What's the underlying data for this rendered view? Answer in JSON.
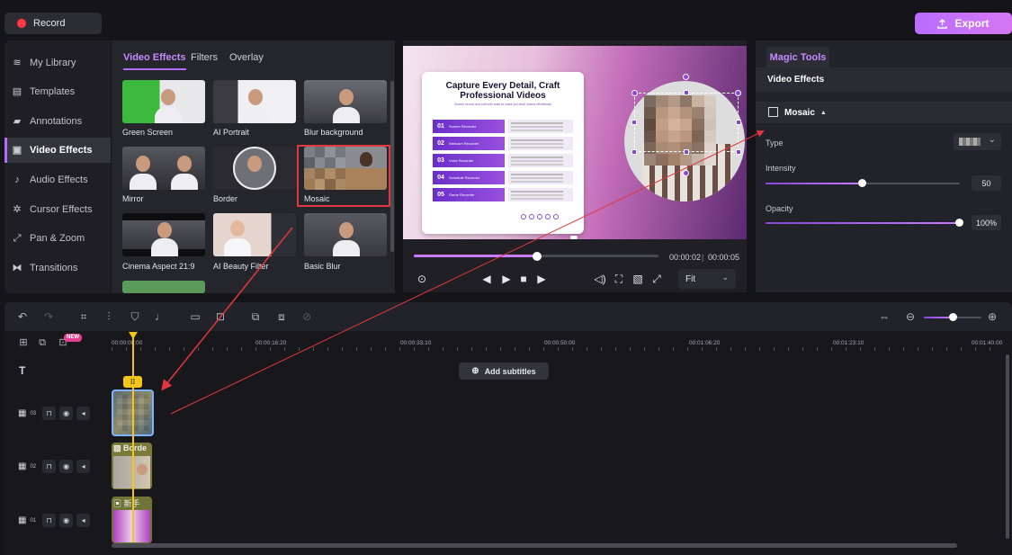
{
  "topbar": {
    "record_label": "Record",
    "export_label": "Export"
  },
  "sidebar": {
    "items": [
      {
        "label": "My Library",
        "icon": "layers-icon"
      },
      {
        "label": "Templates",
        "icon": "template-icon"
      },
      {
        "label": "Annotations",
        "icon": "annotation-icon"
      },
      {
        "label": "Video Effects",
        "icon": "video-effects-icon",
        "active": true
      },
      {
        "label": "Audio Effects",
        "icon": "audio-effects-icon"
      },
      {
        "label": "Cursor Effects",
        "icon": "cursor-icon"
      },
      {
        "label": "Pan & Zoom",
        "icon": "pan-zoom-icon"
      },
      {
        "label": "Transitions",
        "icon": "transitions-icon"
      }
    ]
  },
  "effects": {
    "tabs": [
      "Video Effects",
      "Filters",
      "Overlay"
    ],
    "items": [
      {
        "label": "Green Screen"
      },
      {
        "label": "AI Portrait"
      },
      {
        "label": "Blur background"
      },
      {
        "label": "Mirror"
      },
      {
        "label": "Border"
      },
      {
        "label": "Mosaic",
        "selected": true
      },
      {
        "label": "Cinema Aspect 21:9"
      },
      {
        "label": "AI Beauty Filter"
      },
      {
        "label": "Basic Blur"
      }
    ]
  },
  "preview": {
    "slide_title": "Capture Every Detail, Craft Professional Videos",
    "slide_subtitle": "Screen record and edit with ease to make pro-level videos effortlessly",
    "steps": [
      {
        "num": "01",
        "label": "Screen Recorder"
      },
      {
        "num": "02",
        "label": "Webcam Recorder"
      },
      {
        "num": "03",
        "label": "Voice Recorder"
      },
      {
        "num": "04",
        "label": "Schedule Recorder"
      },
      {
        "num": "05",
        "label": "Game Recorder"
      }
    ],
    "current_time": "00:00:02",
    "total_time": "00:00:05",
    "progress": 0.5,
    "fit_label": "Fit"
  },
  "magic": {
    "tab_label": "Magic Tools",
    "section_label": "Video Effects",
    "effect_name": "Mosaic",
    "type_label": "Type",
    "intensity_label": "Intensity",
    "intensity_value": "50",
    "intensity_fraction": 0.5,
    "opacity_label": "Opacity",
    "opacity_value": "100%",
    "opacity_fraction": 1.0
  },
  "timeline": {
    "ruler": [
      "00:00:00:00",
      "00:00:16:20",
      "00:00:33:10",
      "00:00:50:00",
      "00:01:06:20",
      "00:01:23:10",
      "00:01:40:00"
    ],
    "add_subtitles_label": "Add subtitles",
    "new_badge": "NEW",
    "tracks": [
      {
        "num": "03"
      },
      {
        "num": "02",
        "clip_label": "Borde"
      },
      {
        "num": "01",
        "clip_label": "新手"
      }
    ]
  },
  "colors": {
    "accent": "#b26bff",
    "playhead": "#f5c518",
    "annotation": "#e0383e"
  }
}
